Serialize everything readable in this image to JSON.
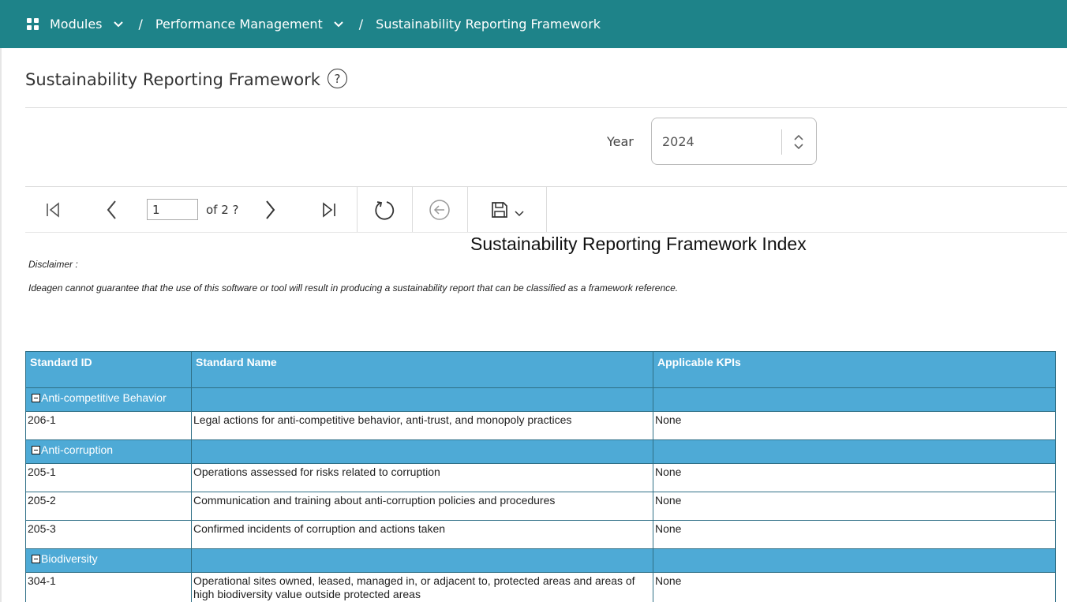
{
  "breadcrumb": {
    "modules_label": "Modules",
    "performance_label": "Performance Management",
    "current_label": "Sustainability Reporting Framework",
    "separator": "/"
  },
  "page": {
    "title": "Sustainability Reporting Framework",
    "help_symbol": "?"
  },
  "filters": {
    "year_label": "Year",
    "year_value": "2024"
  },
  "toolbar": {
    "page_value": "1",
    "page_of": "of 2 ?"
  },
  "report": {
    "title": "Sustainability Reporting Framework Index",
    "disclaimer_label": "Disclaimer :",
    "disclaimer_text": "Ideagen cannot guarantee that the use of this software or tool will result in producing a sustainability report that can be classified as a framework reference.",
    "columns": [
      "Standard ID",
      "Standard Name",
      "Applicable KPIs"
    ],
    "groups": [
      {
        "name": "Anti-competitive Behavior",
        "rows": [
          {
            "id": "206-1",
            "name": "Legal actions for anti-competitive behavior, anti-trust, and monopoly practices",
            "kpis": "None"
          }
        ]
      },
      {
        "name": "Anti-corruption",
        "rows": [
          {
            "id": "205-1",
            "name": "Operations assessed for risks related to corruption",
            "kpis": "None"
          },
          {
            "id": "205-2",
            "name": "Communication and training about anti-corruption policies and procedures",
            "kpis": "None"
          },
          {
            "id": "205-3",
            "name": "Confirmed incidents of corruption and actions taken",
            "kpis": "None"
          }
        ]
      },
      {
        "name": "Biodiversity",
        "rows": [
          {
            "id": "304-1",
            "name": "Operational sites owned, leased, managed in, or adjacent to, protected areas and areas of high biodiversity value outside protected areas",
            "kpis": "None"
          }
        ]
      }
    ]
  },
  "colors": {
    "topbar": "#1e8389",
    "table_header": "#4eaad6",
    "table_border": "#2f6f86"
  }
}
